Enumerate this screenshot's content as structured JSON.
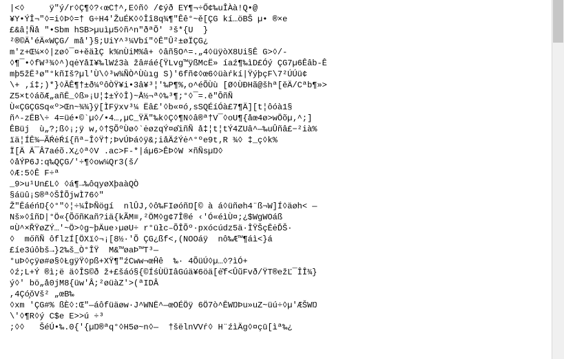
{
  "lines": [
    "|<◊     ÿ\"ý/r◊Ç¶◊?‹œC†^,E◊ñ◊ /¢ýð EY¶¬÷Ő¢‰uÎÀà!Q•@",
    "¥Y•ÝÎ¬\"◊=i◊Þ◊=† G÷H4'ŽuÉK◊◊Îî8q¾¶\"Êê°~ě[ÇG kí…öBŠ µ• ®×e",
    "£&â¦Ñå \"•Sbm hSB>µuìµ5◊ñ^n\"ðªÕ' ³š*{U  }",
    "²®©Ä'éÄ«WÇG/ må'}§;UiY^³¼Vbí\"◊Ê\"Û²±øÏÇG¿",
    "m'z+Œ¼×◊|zø◊¯¤+ĕäłÇ k%nÙiM%â+ ◊âñ§O^=.„4◊üÿòX8Ui§Ê G>◊/-",
    "◊¶¯•◊fW³¾◊^)qėYåI¥‰lWź3à žâ#áé{ŸLvg™ÿßMcË» íaź¶‰ìD£Óý ÇG7µ6Êâb-Ê",
    "mþ5žË³ø\"°kñIš?µl'Ù\\◊³w¾ÑÒ^Ùùıg S)'6fñ¢◊œ6◊üàŕkí|ŸýþçF\\7²ÚÚü¢",
    "\\+ ‚í‡;)*}◊ĀÊ¶†±ð¼ºôÒŸ¥i•3â¥³¦'‰P¶%,o^éÕÙù [Ø◊ÙÐHã@šhª[ĕÄ/Cªb¶»>",
    "Z5×t◊áõÆ„añĒ_◊ß»¡U¦‡±Ý◊Î)~Å½¬ª◊‰³¶;°◊¯=.ē\"ŌñÑ",
    "Ù«ÇGÇGSq«º>Œn~¾¾}ÿ[ÌFÿxv³¼ Ëâ£'◊b«¤ó‚sSQÉíÓà£7¶Ä][t¦ôóà1§",
    "ñ^-zËB\\÷ 4=üé•©`µ◊/•4…‚µC_ŸÄ\"‰k◊Ç◊¶N◊â®ª†V¯◊oU¶{åœ4ø>wÖõµ‚^;]",
    "ÊBüj  ù„?;ß◊¡;ÿ w‚◊†ŞÕºÙø◊`ėøzqÝ¤ø̂iñÑ å‡¦t¦tÝ4ZUâ^—‰uÛñâ£−²ià%",
    "ïä¦ÍĒ¾—ÃŔėŔí{ñª–Î◊Ÿ†;ÞvÚÞá◊ÿ&;iåÄźÝė^°ºe9t‚R ¾◊ ‡_ç◊k%",
    "Ï[Ä Ä¯Â7aéõ.X¿◊ª◊V .ac>F-*|áµ6>ÊÞ◊W ×ñÑsµŊ◊",
    "◊åÝP6J:q‰QÇG/'÷¶◊ow¼Qr3(š/",
    "◊Æ:5◊Ê F÷ª",
    "_9>u¹Un£L◊ ◊á¶→‰ôqyøXþaàQÒ",
    "§áüû¡S®ª◊ŠÎÕjwÌ76◊\"",
    "Ž\"ĒáéńŊ{◊°\"◊¦÷¼ÎÞÑögí  nlÛJ‚◊ô‰FIøóñŊ[© à á◊üñøh4¨ß¬W]Í◊äøh< —",
    "Nš»◊îñD|°Ö«{ÕőñKañ?iä{kÃM≡‚²ÖM◊g¢7Î®é ‹'Ó«éìÙ¤;¿$WgWOáß",
    "¤Ù^×ŘŸøZÝ…'~Ö>◊g~þÄue›µøU÷ r°üłc–ÕÎÕº·pxócúdz5ä·ÎŸŠçĒėĎŠ·",
    "◊  mőñÑ ôflzÍ[ÖXï◊¬¡[8½·'Õ ÇG¿ßf<‚(NOOáÿ  nô‰Æ™¶áì<}á",
    "£íe3úôbš→}2‰š_Ò°ÎŸ  M&™øaÞ™T³—",
    "°uÞ◊çÿø#ø§◊ŁgÿŸ◊pß+XŸ¶\"źCww¬œĤê  ‰· 4ÕüÚ◊µ…◊?ìÓ+",
    "◊ź;L+Ý ®ì;ë ä◊ÎS©ð ž+£šáó§{©ÍśÙÜIâGúä¥6öä[ė̂f<ÛũFvð/ŸT®ežĽ¯ÎÎ¾}",
    "ý◊' bö„å0jM8{üw'Â;²øüàZ'>(ªIDÂ",
    ",4Çó̧ŏVš² „œB‰",
    "◊xm 'ÇG#% ßÈ◊:Œ\"—áôfüäøw·J^WNË^—œOÉÖÿ 6Ö7ò^ĒWŊÞu»uZ~üú÷◊µ'ÆŠWŊ",
    "\\'◊¶R◊ý C$e E>>ú ÷³",
    ";◊◊   ŠéÚ•‰.0{'{µŊ®ªq°◊H5ø~n◊—  †šëlnVVŕ◊ H¨źìÄg◊¤çū[ìª‰¿"
  ]
}
